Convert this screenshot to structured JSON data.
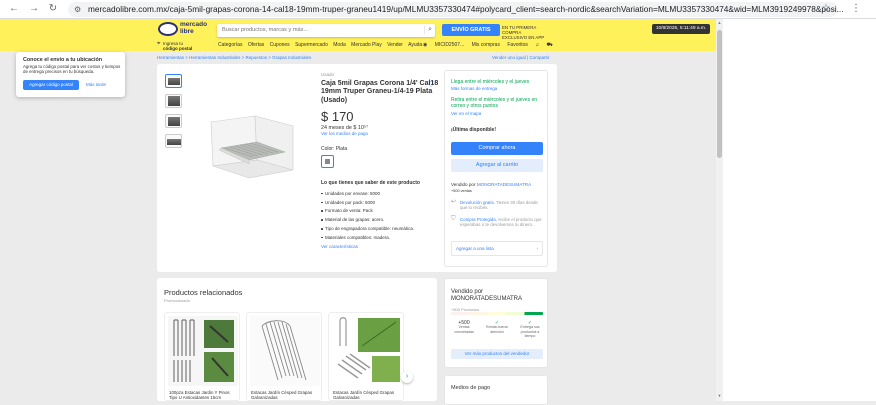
{
  "browser": {
    "url": "mercadolibre.com.mx/caja-5mil-grapas-corona-14-cal18-19mm-truper-graneu1419/up/MLMU3357330474#polycard_client=search-nordic&searchVariation=MLMU3357330474&wid=MLM3919249978&posi..."
  },
  "header": {
    "logo_top": "mercado",
    "logo_bottom": "libre",
    "search_placeholder": "Buscar productos, marcas y más...",
    "promo_badge": "ENVÍO GRATIS",
    "promo_text_1": "EN TU PRIMERA COMPRA",
    "promo_text_2": "EXCLUSIVO EN APP",
    "date_badge": "10/8/2025, 5:11:49 a.m.",
    "location_1": "Ingresa tu",
    "location_2": "código postal",
    "nav": [
      "Categorías",
      "Ofertas",
      "Cupones",
      "Supermercado",
      "Moda",
      "Mercado Play",
      "Vender",
      "Ayuda"
    ],
    "right_nav": [
      "MICID2507...",
      "Mis compras",
      "Favoritos"
    ]
  },
  "popup": {
    "title": "Conoce el envío a tu ubicación",
    "desc": "Agrega tu código postal para ver costos y tiempos de entrega precisos en tu búsqueda.",
    "primary": "Agregar código postal",
    "secondary": "Más tarde"
  },
  "breadcrumbs": "Herramientas  >  Herramientas Industriales  >  Repuestos  >  Grapas Industriales",
  "breadcrumb_right": "Vender uno igual  |  Compartir",
  "product": {
    "condition": "Usado",
    "title": "Caja 5mil Grapas Corona 1/4' Cal18 19mm Truper Graneu-1/4-19 Plata (Usado)",
    "price": "$ 170",
    "installments": "24 meses de $ 10⁵⁷",
    "payment_link": "Ver los medios de pago",
    "color_label": "Color: Plata",
    "features_title": "Lo que tienes que saber de este producto",
    "features": [
      "Unidades por envase: 5000",
      "Unidades por pack: 5000",
      "Formato de venta: Pack",
      "Material de las grapas: acero.",
      "Tipo de engrapadora compatible: neumática.",
      "Materiales compatibles: madera."
    ],
    "features_link": "Ver características"
  },
  "buybox": {
    "delivery_1": "Llega entre el miércoles y el jueves",
    "delivery_1_link": "Más formas de entrega",
    "delivery_2": "Retira entre el miércoles y el jueves en correo y otros puntos",
    "delivery_2_link": "Ver en el mapa",
    "stock": "¡Última disponible!",
    "buy": "Comprar ahora",
    "cart": "Agregar al carrito",
    "seller_prefix": "Vendido por",
    "seller": "MONORATADESUMATRA",
    "seller_sales": "+500 ventas",
    "return_link": "Devolución gratis.",
    "return_text": "Tienes 30 días desde que lo recibes.",
    "protect_link": "Compra Protegida,",
    "protect_text": "recibe el producto que esperabas o te devolvemos tu dinero.",
    "list_btn": "Agregar a una lista"
  },
  "related": {
    "title": "Productos relacionados",
    "subtitle": "Promocionado",
    "items": [
      "100pza Estacas Jardin Y Pinos Tipo U Antioxidantes 15cm",
      "Estacas Jardín Césped Grapas Galvanizadas",
      "Estacas Jardín Césped Grapas Galvanizadas"
    ]
  },
  "seller_card": {
    "title": "Vendido por MONORATADESUMATRA",
    "sub": "+500 Productos",
    "stats": [
      {
        "v": "+500",
        "l": "Ventas concretadas"
      },
      {
        "v": "✓",
        "l": "Brinda buena atención"
      },
      {
        "v": "✓",
        "l": "Entrega sus productos a tiempo"
      }
    ],
    "button": "Ver más productos del vendedor"
  },
  "pay_card": {
    "title": "Medios de pago"
  },
  "colors": {
    "brand_yellow": "#fff159",
    "accent_blue": "#3483fa"
  }
}
